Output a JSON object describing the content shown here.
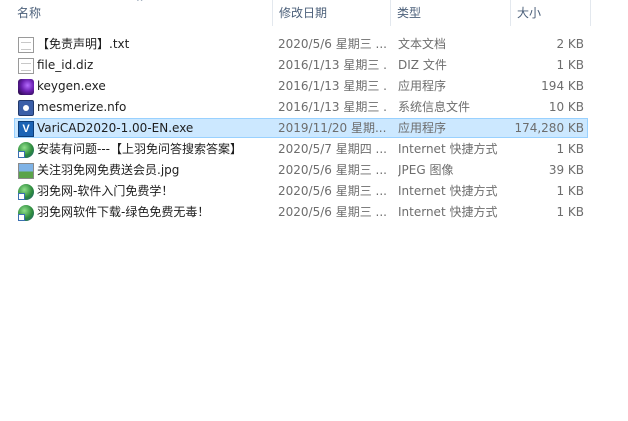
{
  "columns": {
    "name": "名称",
    "date": "修改日期",
    "type": "类型",
    "size": "大小"
  },
  "files": [
    {
      "name": "【免责声明】.txt",
      "date": "2020/5/6 星期三 ...",
      "type": "文本文档",
      "size": "2 KB",
      "icon": "text-document-icon"
    },
    {
      "name": "file_id.diz",
      "date": "2016/1/13 星期三 ...",
      "type": "DIZ 文件",
      "size": "1 KB",
      "icon": "file-icon"
    },
    {
      "name": "keygen.exe",
      "date": "2016/1/13 星期三 ...",
      "type": "应用程序",
      "size": "194 KB",
      "icon": "keygen-app-icon"
    },
    {
      "name": "mesmerize.nfo",
      "date": "2016/1/13 星期三 ...",
      "type": "系统信息文件",
      "size": "10 KB",
      "icon": "system-info-icon"
    },
    {
      "name": "VariCAD2020-1.00-EN.exe",
      "date": "2019/11/20 星期...",
      "type": "应用程序",
      "size": "174,280 KB",
      "icon": "varicad-app-icon",
      "selected": true
    },
    {
      "name": "安装有问题---【上羽免问答搜索答案】",
      "date": "2020/5/7 星期四 ...",
      "type": "Internet 快捷方式",
      "size": "1 KB",
      "icon": "internet-shortcut-icon"
    },
    {
      "name": "关注羽免网免费送会员.jpg",
      "date": "2020/5/6 星期三 ...",
      "type": "JPEG 图像",
      "size": "39 KB",
      "icon": "jpeg-image-icon"
    },
    {
      "name": "羽免网-软件入门免费学！",
      "date": "2020/5/6 星期三 ...",
      "type": "Internet 快捷方式",
      "size": "1 KB",
      "icon": "internet-shortcut-icon"
    },
    {
      "name": "羽免网软件下载-绿色免费无毒！",
      "date": "2020/5/6 星期三 ...",
      "type": "Internet 快捷方式",
      "size": "1 KB",
      "icon": "internet-shortcut-icon"
    }
  ],
  "colors": {
    "selection_bg": "#cce8ff",
    "selection_border": "#99d1ff",
    "header_text": "#4c607a"
  }
}
